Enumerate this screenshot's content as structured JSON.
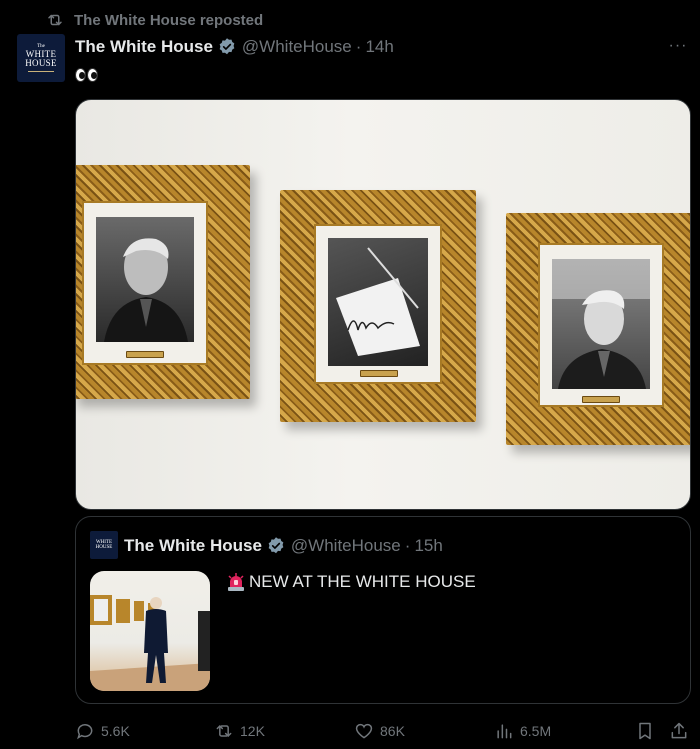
{
  "repost_line": {
    "icon": "repost-icon",
    "label": "The White House reposted"
  },
  "avatar": {
    "line1": "The",
    "line2": "WHITE",
    "line3": "HOUSE"
  },
  "tweet": {
    "name": "The White House",
    "handle": "@WhiteHouse",
    "dot": "·",
    "time": "14h",
    "text_emoji": "eyes",
    "more_label": "···"
  },
  "quoted": {
    "name": "The White House",
    "handle": "@WhiteHouse",
    "dot": "·",
    "time": "15h",
    "text": "NEW AT THE WHITE HOUSE"
  },
  "actions": {
    "reply": "5.6K",
    "repost": "12K",
    "like": "86K",
    "views": "6.5M"
  },
  "colors": {
    "background": "#000000",
    "text": "#e7e9ea",
    "muted": "#71767b",
    "border": "#2f3336",
    "verified": "#829aab",
    "gold": "#b8862b"
  }
}
